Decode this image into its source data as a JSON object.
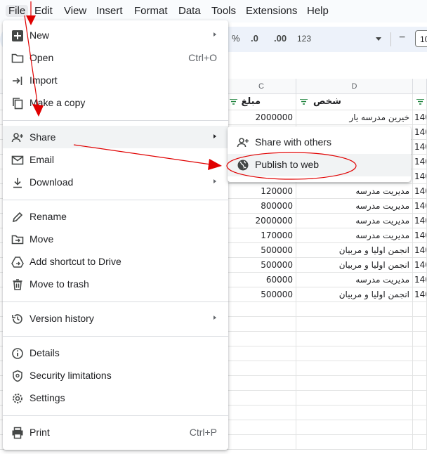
{
  "menubar": {
    "items": [
      {
        "label": "File"
      },
      {
        "label": "Edit"
      },
      {
        "label": "View"
      },
      {
        "label": "Insert"
      },
      {
        "label": "Format"
      },
      {
        "label": "Data"
      },
      {
        "label": "Tools"
      },
      {
        "label": "Extensions"
      },
      {
        "label": "Help"
      }
    ]
  },
  "toolbar": {
    "percent": "%",
    "decrease_decimal": ".0",
    "increase_decimal": ".00",
    "number_format": "123",
    "minus": "−",
    "font_size": "10"
  },
  "columns": {
    "c": "C",
    "d": "D"
  },
  "header_row": {
    "c": "مبلغ",
    "d": "شخص"
  },
  "rows": [
    {
      "amount": "2000000",
      "person": "خیرین مدرسه یار",
      "e": "140"
    },
    {
      "amount": "",
      "person": "",
      "e": "140"
    },
    {
      "amount": "",
      "person": "",
      "e": "140"
    },
    {
      "amount": "",
      "person": "",
      "e": "140"
    },
    {
      "amount": "",
      "person": "",
      "e": "140"
    },
    {
      "amount": "120000",
      "person": "مدیریت مدرسه",
      "e": "140"
    },
    {
      "amount": "800000",
      "person": "مدیریت مدرسه",
      "e": "140"
    },
    {
      "amount": "2000000",
      "person": "مدیریت مدرسه",
      "e": "140"
    },
    {
      "amount": "170000",
      "person": "مدیریت مدرسه",
      "e": "140"
    },
    {
      "amount": "500000",
      "person": "انجمن اولیا و مربیان",
      "e": "140"
    },
    {
      "amount": "500000",
      "person": "انجمن اولیا و مربیان",
      "e": "140"
    },
    {
      "amount": "60000",
      "person": "مدیریت مدرسه",
      "e": "140"
    },
    {
      "amount": "500000",
      "person": "انجمن اولیا و مربیان",
      "e": "140"
    }
  ],
  "file_menu": {
    "new": "New",
    "open": "Open",
    "open_shortcut": "Ctrl+O",
    "import": "Import",
    "make_copy": "Make a copy",
    "share": "Share",
    "email": "Email",
    "download": "Download",
    "rename": "Rename",
    "move": "Move",
    "add_shortcut": "Add shortcut to Drive",
    "trash": "Move to trash",
    "version_history": "Version history",
    "details": "Details",
    "security": "Security limitations",
    "settings": "Settings",
    "print": "Print",
    "print_shortcut": "Ctrl+P"
  },
  "share_submenu": {
    "share_with_others": "Share with others",
    "publish_to_web": "Publish to web"
  },
  "annotation_color": "#e00000"
}
